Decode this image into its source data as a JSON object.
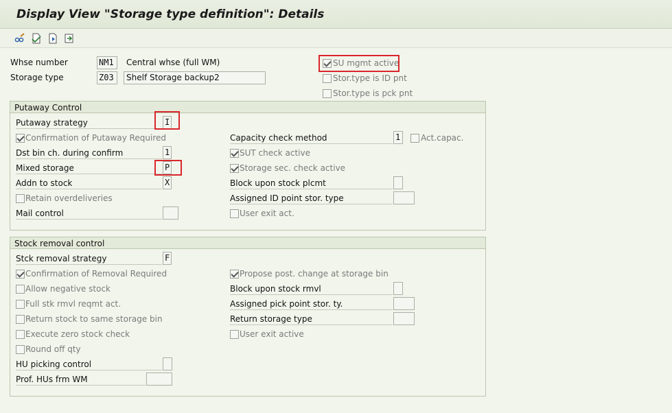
{
  "title": "Display View \"Storage type definition\": Details",
  "toolbar": {
    "icons": [
      "glasses-pencil-icon",
      "new-entries-icon",
      "next-entry-icon",
      "export-icon"
    ]
  },
  "header": {
    "whse_number": {
      "label": "Whse number",
      "value": "NM1",
      "desc": "Central whse (full WM)"
    },
    "storage_type": {
      "label": "Storage type",
      "value": "Z03",
      "desc": "Shelf Storage backup2"
    },
    "su_mgmt_active": {
      "label": "SU mgmt active",
      "checked": true
    },
    "stor_type_id_pnt": {
      "label": "Stor.type is ID pnt",
      "checked": false
    },
    "stor_type_pck_pnt": {
      "label": "Stor.type is pck pnt",
      "checked": false
    }
  },
  "putaway": {
    "title": "Putaway Control",
    "strategy": {
      "label": "Putaway strategy",
      "value": "I"
    },
    "confirmation": {
      "label": "Confirmation of Putaway Required",
      "checked": true
    },
    "dst_bin": {
      "label": "Dst bin ch. during confirm",
      "value": "1"
    },
    "mixed_storage": {
      "label": "Mixed storage",
      "value": "P"
    },
    "addn_to_stock": {
      "label": "Addn to stock",
      "value": "X"
    },
    "retain_overdeliveries": {
      "label": "Retain overdeliveries",
      "checked": false
    },
    "mail_control": {
      "label": "Mail control",
      "value": ""
    },
    "capacity_check": {
      "label": "Capacity check method",
      "value": "1"
    },
    "act_capac": {
      "label": "Act.capac.",
      "checked": false
    },
    "sut_check": {
      "label": "SUT check active",
      "checked": true
    },
    "storage_sec_check": {
      "label": "Storage sec. check active",
      "checked": true
    },
    "block_upon_plcmt": {
      "label": "Block upon stock plcmt",
      "value": ""
    },
    "assigned_id_point": {
      "label": "Assigned ID point stor. type",
      "value": ""
    },
    "user_exit": {
      "label": "User exit act.",
      "checked": false
    }
  },
  "removal": {
    "title": "Stock removal control",
    "strategy": {
      "label": "Stck removal strategy",
      "value": "F"
    },
    "confirmation": {
      "label": "Confirmation of Removal Required",
      "checked": true
    },
    "allow_negative": {
      "label": "Allow negative stock",
      "checked": false
    },
    "full_stk_rmvl": {
      "label": "Full stk rmvl reqmt act.",
      "checked": false
    },
    "return_same_bin": {
      "label": "Return stock to same storage bin",
      "checked": false
    },
    "zero_stock_check": {
      "label": "Execute zero stock check",
      "checked": false
    },
    "round_off": {
      "label": "Round off qty",
      "checked": false
    },
    "hu_picking": {
      "label": "HU picking control",
      "value": ""
    },
    "prof_hus": {
      "label": "Prof. HUs frm WM",
      "value": ""
    },
    "propose_post_change": {
      "label": "Propose post. change at storage bin",
      "checked": true
    },
    "block_upon_rmvl": {
      "label": "Block upon stock rmvl",
      "value": ""
    },
    "assigned_pick_point": {
      "label": "Assigned pick point stor. ty.",
      "value": ""
    },
    "return_storage_type": {
      "label": "Return storage type",
      "value": ""
    },
    "user_exit": {
      "label": "User exit active",
      "checked": false
    }
  },
  "colors": {
    "highlight": "#d9262c",
    "background": "#f2f5ec"
  }
}
